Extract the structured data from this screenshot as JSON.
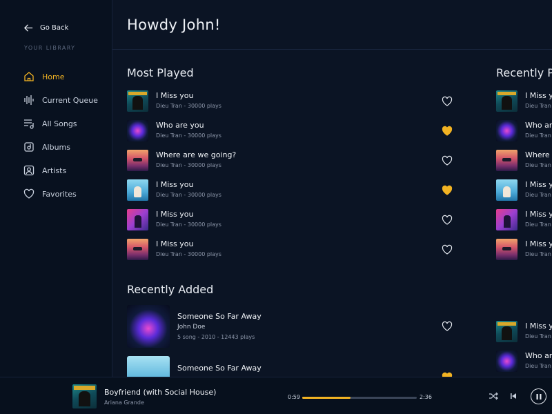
{
  "sidebar": {
    "back_label": "Go Back",
    "library_label": "YOUR LIBRARY",
    "items": [
      {
        "label": "Home",
        "icon": "home-icon",
        "active": true
      },
      {
        "label": "Current Queue",
        "icon": "equalizer-icon",
        "active": false
      },
      {
        "label": "All Songs",
        "icon": "playlist-icon",
        "active": false
      },
      {
        "label": "Albums",
        "icon": "album-icon",
        "active": false
      },
      {
        "label": "Artists",
        "icon": "artist-icon",
        "active": false
      },
      {
        "label": "Favorites",
        "icon": "heart-icon",
        "active": false
      }
    ]
  },
  "header": {
    "greeting": "Howdy John!"
  },
  "most_played": {
    "title": "Most Played",
    "songs": [
      {
        "title": "I Miss you",
        "meta": "Dieu Tran - 30000 plays",
        "favorite": false
      },
      {
        "title": "Who are you",
        "meta": "Dieu Tran - 30000 plays",
        "favorite": true
      },
      {
        "title": "Where are we going?",
        "meta": "Dieu Tran - 30000 plays",
        "favorite": false
      },
      {
        "title": "I Miss you",
        "meta": "Dieu Tran - 30000 plays",
        "favorite": true
      },
      {
        "title": "I Miss you",
        "meta": "Dieu Tran - 30000 plays",
        "favorite": false
      },
      {
        "title": "I Miss you",
        "meta": "Dieu Tran - 30000 plays",
        "favorite": false
      }
    ]
  },
  "recently_added": {
    "title": "Recently Added",
    "items": [
      {
        "title": "Someone So Far Away",
        "artist": "John Doe",
        "meta": "5 song - 2010 - 12443 plays",
        "favorite": false
      },
      {
        "title": "Someone So Far Away",
        "artist": "",
        "meta": "",
        "favorite": true
      }
    ]
  },
  "recently_played": {
    "title": "Recently P",
    "songs": [
      {
        "title": "I Miss y",
        "meta": "Dieu Tran"
      },
      {
        "title": "Who ar",
        "meta": "Dieu Tran"
      },
      {
        "title": "Where",
        "meta": "Dieu Tran"
      },
      {
        "title": "I Miss y",
        "meta": "Dieu Tran"
      },
      {
        "title": "I Miss y",
        "meta": "Dieu Tran"
      },
      {
        "title": "I Miss y",
        "meta": "Dieu Tran"
      },
      {
        "title": "I Miss y",
        "meta": "Dieu Tran"
      },
      {
        "title": "Who ar",
        "meta": "Dieu Tran"
      }
    ]
  },
  "player": {
    "title": "Boyfriend (with Social House)",
    "artist": "Ariana Grande",
    "current_time": "0:59",
    "total_time": "2:36",
    "progress": 0.42
  },
  "colors": {
    "accent": "#f2b323",
    "background": "#0b1424",
    "sidebar": "#08111f"
  }
}
